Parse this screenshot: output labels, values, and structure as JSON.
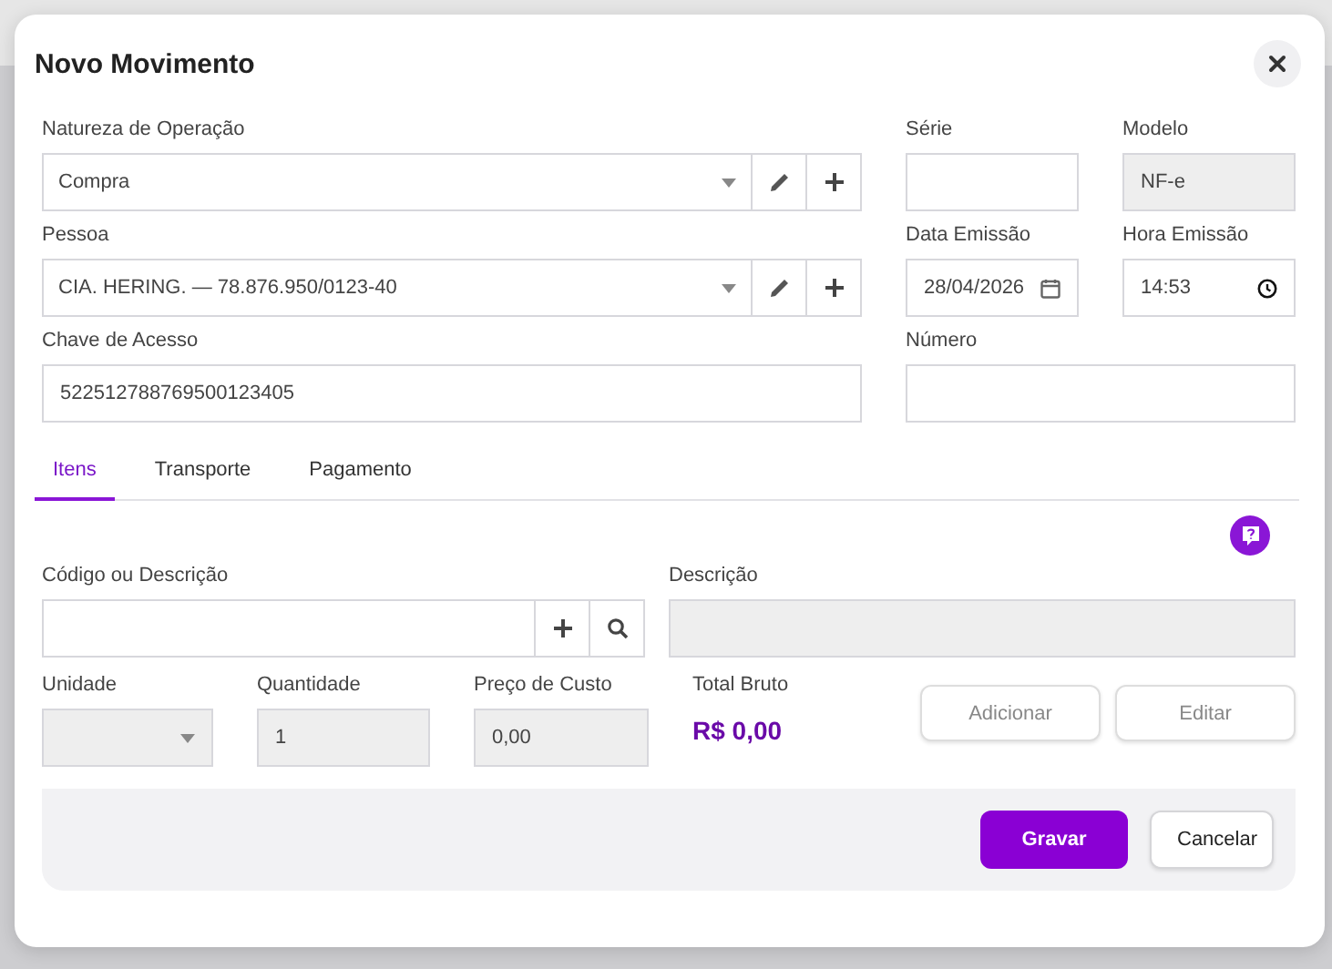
{
  "dialog": {
    "title": "Novo Movimento"
  },
  "header_fields": {
    "natureza": {
      "label": "Natureza de Operação",
      "value": "Compra"
    },
    "serie": {
      "label": "Série"
    },
    "modelo": {
      "label": "Modelo",
      "value": "NF-e",
      "disabled": true
    },
    "pessoa": {
      "label": "Pessoa",
      "value": "CIA. HERING. — 78.876.950/0123-40"
    },
    "data": {
      "label": "Data Emissão",
      "value": "28/04/2026"
    },
    "hora": {
      "label": "Hora Emissão",
      "value": "14:53"
    },
    "chave": {
      "label": "Chave de Acesso",
      "value": "522512788769500123405"
    },
    "numero": {
      "label": "Número"
    }
  },
  "tabs": [
    {
      "label": "Itens",
      "selected": true
    },
    {
      "label": "Transporte",
      "selected": false
    },
    {
      "label": "Pagamento",
      "selected": false
    }
  ],
  "items": {
    "codigo": {
      "label": "Código ou Descrição"
    },
    "descricao": {
      "label": "Descrição",
      "disabled": true
    },
    "unidade": {
      "label": "Unidade",
      "disabled": true
    },
    "quantidade": {
      "label": "Quantidade",
      "value": "1",
      "disabled": true
    },
    "preco": {
      "label": "Preço de Custo",
      "value": "0,00",
      "disabled": true
    },
    "total": {
      "label": "Total Bruto",
      "value": "R$ 0,00"
    },
    "buttons": [
      {
        "label": "Adicionar",
        "disabled": true
      },
      {
        "label": "Editar",
        "disabled": true
      }
    ]
  },
  "footer_buttons": [
    {
      "label": "Gravar",
      "kind": "primary"
    },
    {
      "label": "Cancelar",
      "kind": "secondary"
    }
  ]
}
